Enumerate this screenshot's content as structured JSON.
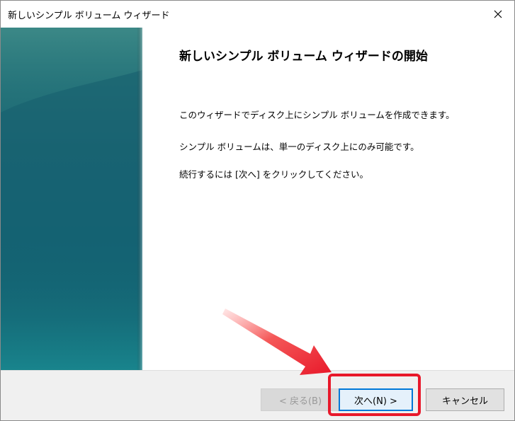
{
  "window": {
    "title": "新しいシンプル ボリューム ウィザード",
    "close_icon": "close-icon"
  },
  "content": {
    "heading": "新しいシンプル ボリューム ウィザードの開始",
    "paragraphs": [
      "このウィザードでディスク上にシンプル ボリュームを作成できます。",
      "シンプル ボリュームは、単一のディスク上にのみ可能です。",
      "続行するには [次へ] をクリックしてください。"
    ]
  },
  "buttons": {
    "back": "< 戻る(B)",
    "next": "次へ(N) >",
    "cancel": "キャンセル"
  },
  "colors": {
    "accent": "#0078d7",
    "highlight": "#e8182a",
    "panel_teal": "#136677"
  }
}
